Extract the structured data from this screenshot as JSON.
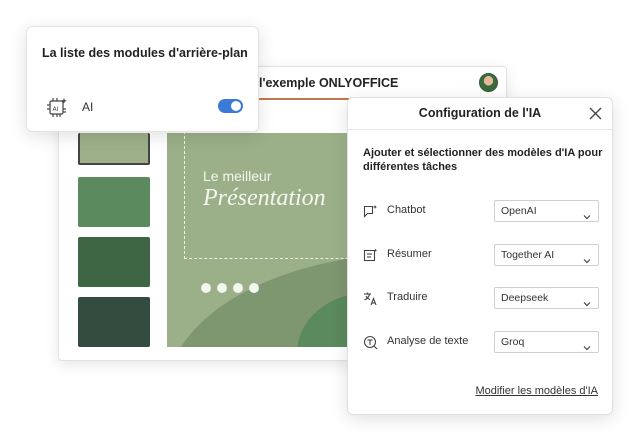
{
  "editor": {
    "title": "l'exemple ONLYOFFICE",
    "slide": {
      "subtitle": "Le meilleur",
      "title": "Présentation"
    }
  },
  "plugins_popup": {
    "title": "La liste des modules d'arrière-plan",
    "items": [
      {
        "label": "AI",
        "icon": "ai-chip-icon",
        "enabled": true
      }
    ]
  },
  "ai_dialog": {
    "title": "Configuration de l'IA",
    "description": "Ajouter et sélectionner des modèles d'IA pour différentes tâches",
    "rows": [
      {
        "icon": "chat-icon",
        "label": "Chatbot",
        "value": "OpenAI"
      },
      {
        "icon": "summarize-icon",
        "label": "Résumer",
        "value": "Together AI"
      },
      {
        "icon": "translate-icon",
        "label": "Traduire",
        "value": "Deepseek"
      },
      {
        "icon": "text-analysis-icon",
        "label": "Analyse de texte",
        "value": "Groq"
      }
    ],
    "link": "Modifier les modèles d'IA"
  },
  "colors": {
    "accent": "#3b7ad6",
    "title_underline": "#c6764f",
    "slide_bg": "#9bb089"
  }
}
